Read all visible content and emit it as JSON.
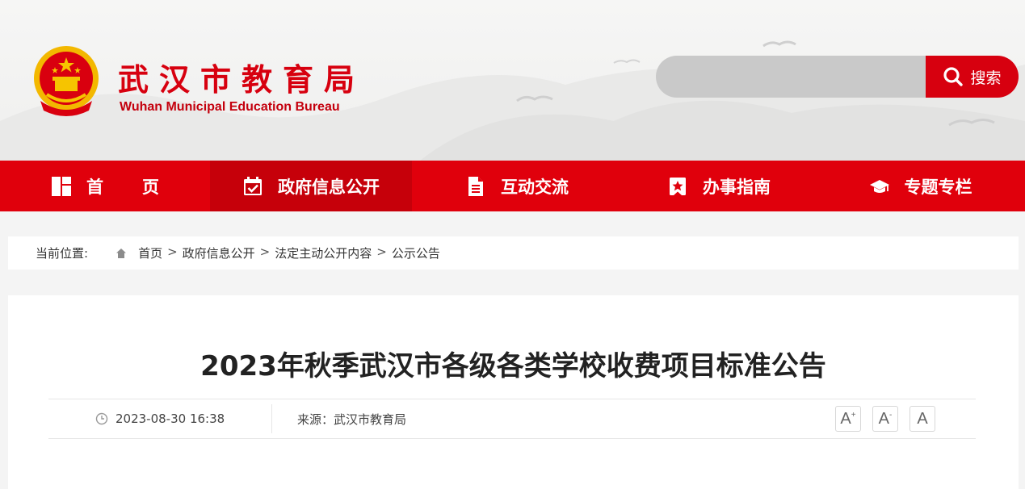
{
  "header": {
    "site_title": "武汉市教育局",
    "site_subtitle": "Wuhan Municipal Education Bureau",
    "emblem_icon": "national-emblem-icon",
    "search": {
      "placeholder": "",
      "button_label": "搜索",
      "icon": "search-icon"
    }
  },
  "colors": {
    "brand_red": "#e0000c",
    "active_red": "#c6000a",
    "search_gray": "#c9c9c9"
  },
  "nav": {
    "items": [
      {
        "label": "首页",
        "icon": "home-grid-icon"
      },
      {
        "label": "政府信息公开",
        "icon": "calendar-check-icon",
        "active": true
      },
      {
        "label": "互动交流",
        "icon": "document-icon"
      },
      {
        "label": "办事指南",
        "icon": "bookmark-star-icon"
      },
      {
        "label": "专题专栏",
        "icon": "graduation-cap-icon"
      }
    ]
  },
  "breadcrumb": {
    "label": "当前位置:",
    "items": [
      "首页",
      "政府信息公开",
      "法定主动公开内容",
      "公示公告"
    ],
    "separator": ">"
  },
  "article": {
    "title": "2023年秋季武汉市各级各类学校收费项目标准公告",
    "date": "2023-08-30 16:38",
    "source": "来源：武汉市教育局",
    "font_buttons": [
      "A",
      "A",
      "A"
    ]
  }
}
